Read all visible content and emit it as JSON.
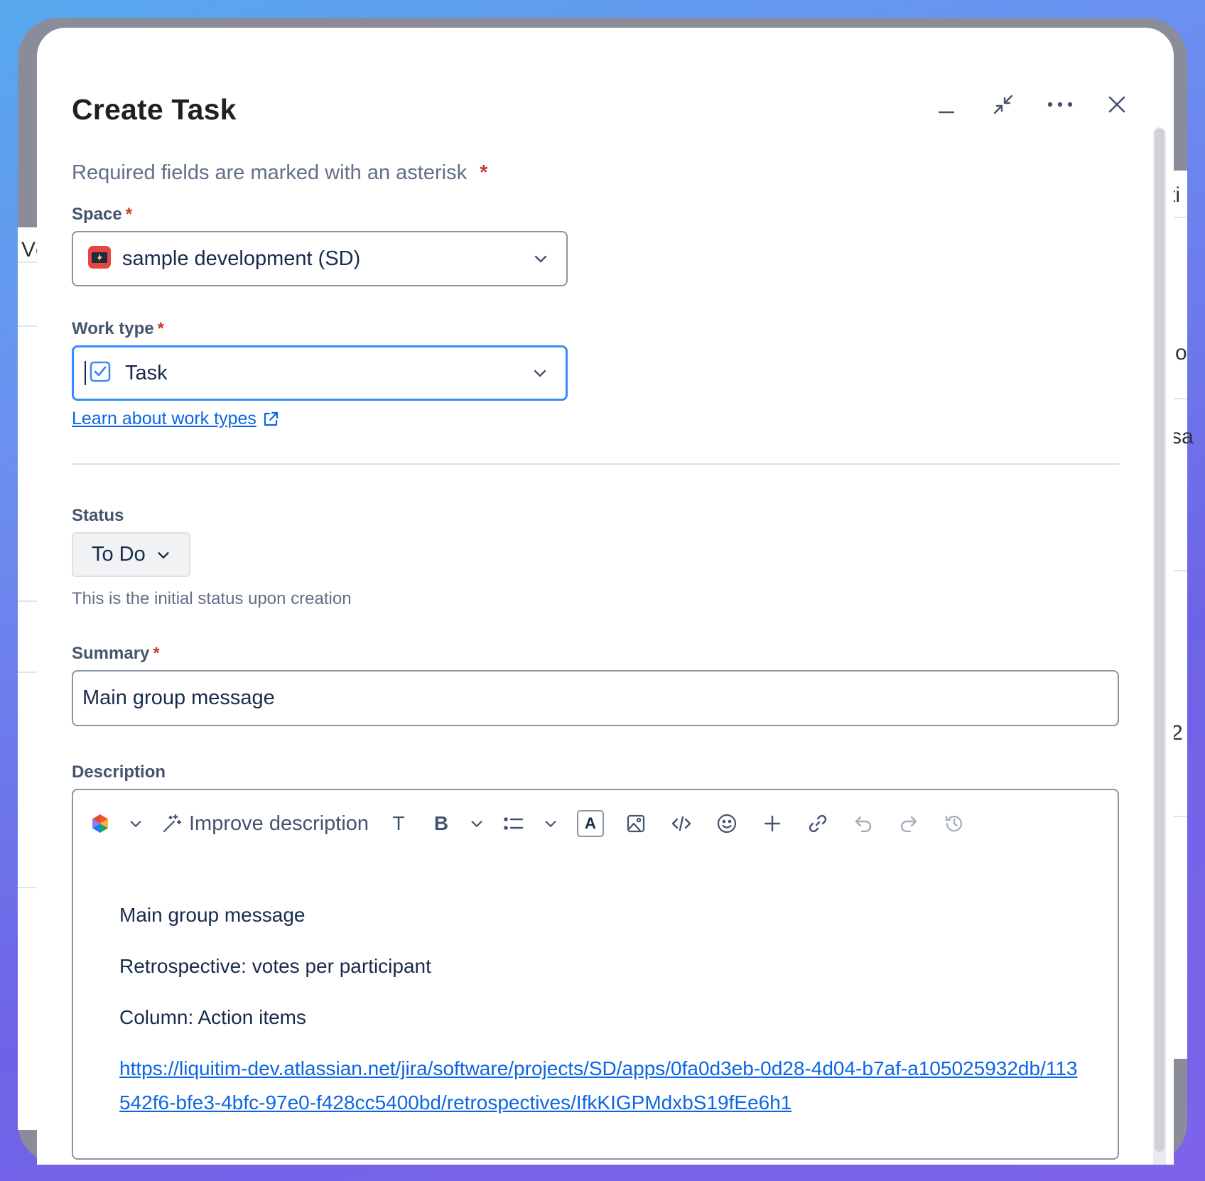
{
  "dialog": {
    "title": "Create Task",
    "required_note": "Required fields are marked with an asterisk",
    "required_marker": "*"
  },
  "header_actions": [
    {
      "name": "minimize",
      "icon": "minimize-icon"
    },
    {
      "name": "collapse",
      "icon": "collapse-icon"
    },
    {
      "name": "more",
      "icon": "more-icon"
    },
    {
      "name": "close",
      "icon": "close-icon"
    }
  ],
  "fields": {
    "space": {
      "label": "Space",
      "value": "sample development (SD)",
      "icon": "project-icon"
    },
    "work_type": {
      "label": "Work type",
      "value": "Task",
      "icon": "task-checkbox-icon",
      "link_text": "Learn about work types"
    },
    "status": {
      "label": "Status",
      "value": "To Do",
      "helper": "This is the initial status upon creation"
    },
    "summary": {
      "label": "Summary",
      "value": "Main group message"
    },
    "description": {
      "label": "Description",
      "toolbar": {
        "improve_label": "Improve description",
        "text_style_glyph": "T",
        "bold_glyph": "B",
        "text_color_glyph": "A"
      },
      "paragraphs": [
        "Main group message",
        "Retrospective: votes per participant",
        "Column: Action items"
      ],
      "link": "https://liquitim-dev.atlassian.net/jira/software/projects/SD/apps/0fa0d3eb-0d28-4d04-b7af-a105025932db/113542f6-bfe3-4bfc-97e0-f428cc5400bd/retrospectives/IfkKIGPMdxbS19fEe6h1"
    }
  },
  "background_fragments": [
    "Vc",
    "ti",
    "o",
    "sa",
    "2"
  ],
  "colors": {
    "accent": "#0c66e4",
    "focus_border": "#388bff",
    "required": "#c9372c",
    "project_icon": "#e2483d"
  }
}
